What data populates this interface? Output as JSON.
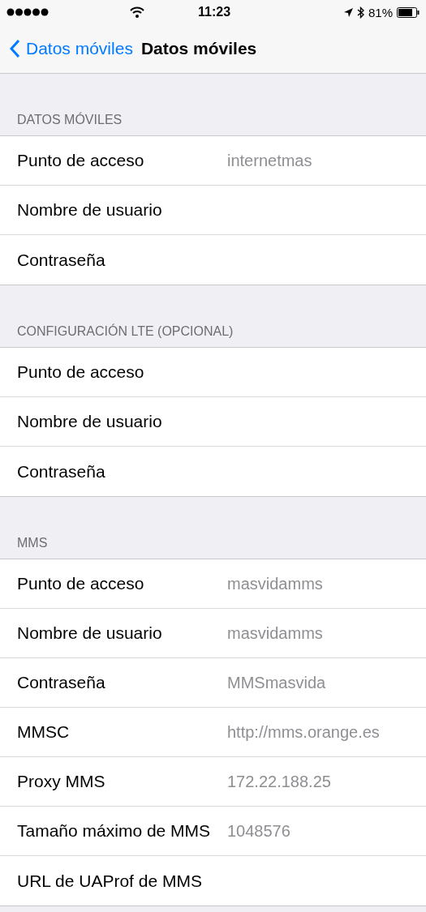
{
  "status_bar": {
    "time": "11:23",
    "battery": "81%"
  },
  "nav": {
    "back": "Datos móviles",
    "title": "Datos móviles"
  },
  "sections": [
    {
      "header": "DATOS MÓVILES",
      "rows": [
        {
          "label": "Punto de acceso",
          "value": "internetmas"
        },
        {
          "label": "Nombre de usuario"
        },
        {
          "label": "Contraseña"
        }
      ]
    },
    {
      "header": "CONFIGURACIÓN LTE (OPCIONAL)",
      "rows": [
        {
          "label": "Punto de acceso"
        },
        {
          "label": "Nombre de usuario"
        },
        {
          "label": "Contraseña"
        }
      ]
    },
    {
      "header": "MMS",
      "rows": [
        {
          "label": "Punto de acceso",
          "value": "masvidamms"
        },
        {
          "label": "Nombre de usuario",
          "value": "masvidamms"
        },
        {
          "label": "Contraseña",
          "value": "MMSmasvida"
        },
        {
          "label": "MMSC",
          "value": "http://mms.orange.es"
        },
        {
          "label": "Proxy MMS",
          "value": "172.22.188.25"
        },
        {
          "label": "Tamaño máximo de MMS",
          "value": "1048576"
        },
        {
          "label": "URL de UAProf de MMS"
        }
      ]
    }
  ]
}
